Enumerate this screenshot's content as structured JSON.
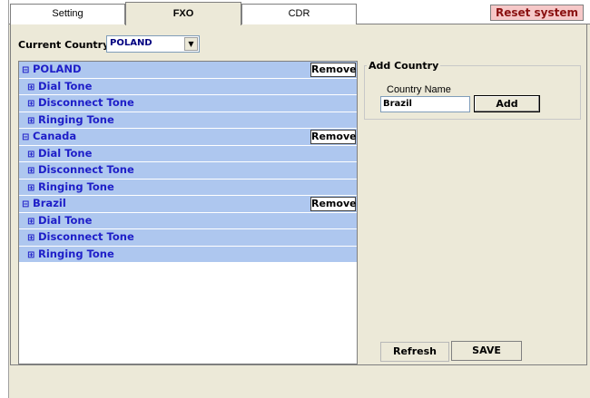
{
  "tabs": [
    {
      "label": "Setting",
      "active": false
    },
    {
      "label": "FXO",
      "active": true
    },
    {
      "label": "CDR",
      "active": false
    }
  ],
  "reset_label": "Reset system",
  "current_country": {
    "label": "Current Country",
    "value": "POLAND"
  },
  "tree": [
    {
      "country": "POLAND",
      "remove_label": "Remove",
      "tones": [
        "Dial Tone",
        "Disconnect Tone",
        "Ringing Tone"
      ]
    },
    {
      "country": "Canada",
      "remove_label": "Remove",
      "tones": [
        "Dial Tone",
        "Disconnect Tone",
        "Ringing Tone"
      ]
    },
    {
      "country": "Brazil",
      "remove_label": "Remove",
      "tones": [
        "Dial Tone",
        "Disconnect Tone",
        "Ringing Tone"
      ]
    }
  ],
  "add_country": {
    "title": "Add Country",
    "name_label": "Country Name",
    "name_value": "Brazil",
    "add_label": "Add"
  },
  "refresh_label": "Refresh",
  "save_label": "SAVE",
  "colors": {
    "row_bg": "#aec7ef",
    "row_text": "#1e1ec8",
    "reset_bg": "#f6c8c8",
    "reset_text": "#8a1010"
  }
}
